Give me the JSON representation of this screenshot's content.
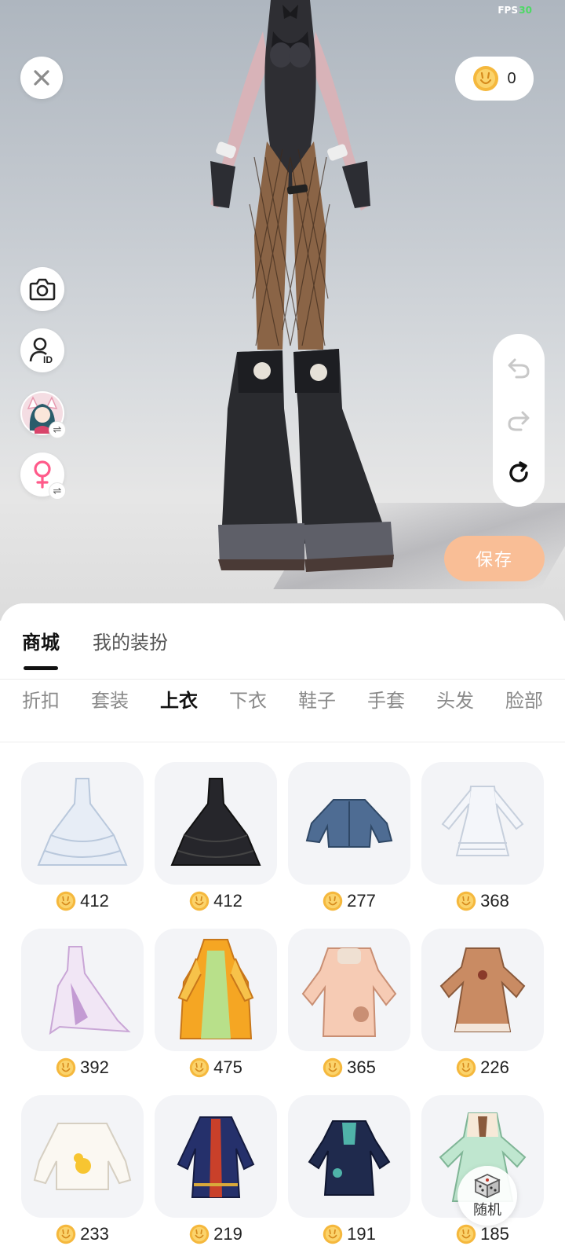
{
  "status": {
    "fps_label": "FPS",
    "fps_value": "30"
  },
  "header": {
    "coin_balance": "0"
  },
  "side_buttons": [
    {
      "name": "camera-button",
      "icon": "camera-icon"
    },
    {
      "name": "profile-id-button",
      "icon": "user-id-icon"
    },
    {
      "name": "avatar-switch-button",
      "icon": "avatar-thumbnail"
    },
    {
      "name": "gender-switch-button",
      "icon": "female-icon"
    }
  ],
  "history": {
    "undo_icon": "undo-icon",
    "redo_icon": "redo-icon",
    "reset_icon": "reset-icon"
  },
  "save_label": "保存",
  "main_tabs": [
    {
      "label": "商城",
      "active": true
    },
    {
      "label": "我的装扮",
      "active": false
    }
  ],
  "categories": [
    {
      "label": "折扣",
      "active": false
    },
    {
      "label": "套装",
      "active": false
    },
    {
      "label": "上衣",
      "active": true
    },
    {
      "label": "下衣",
      "active": false
    },
    {
      "label": "鞋子",
      "active": false
    },
    {
      "label": "手套",
      "active": false
    },
    {
      "label": "头发",
      "active": false
    },
    {
      "label": "脸部",
      "active": false
    }
  ],
  "items": [
    {
      "price": "412",
      "kind": "white-ball-gown"
    },
    {
      "price": "412",
      "kind": "black-ball-gown"
    },
    {
      "price": "277",
      "kind": "denim-jacket"
    },
    {
      "price": "368",
      "kind": "white-lolita-dress"
    },
    {
      "price": "392",
      "kind": "lavender-gown"
    },
    {
      "price": "475",
      "kind": "orange-hanfu-dress"
    },
    {
      "price": "365",
      "kind": "peach-bear-coat"
    },
    {
      "price": "226",
      "kind": "brown-bear-dress"
    },
    {
      "price": "233",
      "kind": "white-duck-sweater"
    },
    {
      "price": "219",
      "kind": "navy-ornate-robe"
    },
    {
      "price": "191",
      "kind": "navy-teal-robe"
    },
    {
      "price": "185",
      "kind": "mint-vintage-dress"
    }
  ],
  "random_label": "随机",
  "colors": {
    "accent_save": "#f9be96",
    "coin_gold": "#f5b83d",
    "female_pink": "#ff5a8a"
  }
}
